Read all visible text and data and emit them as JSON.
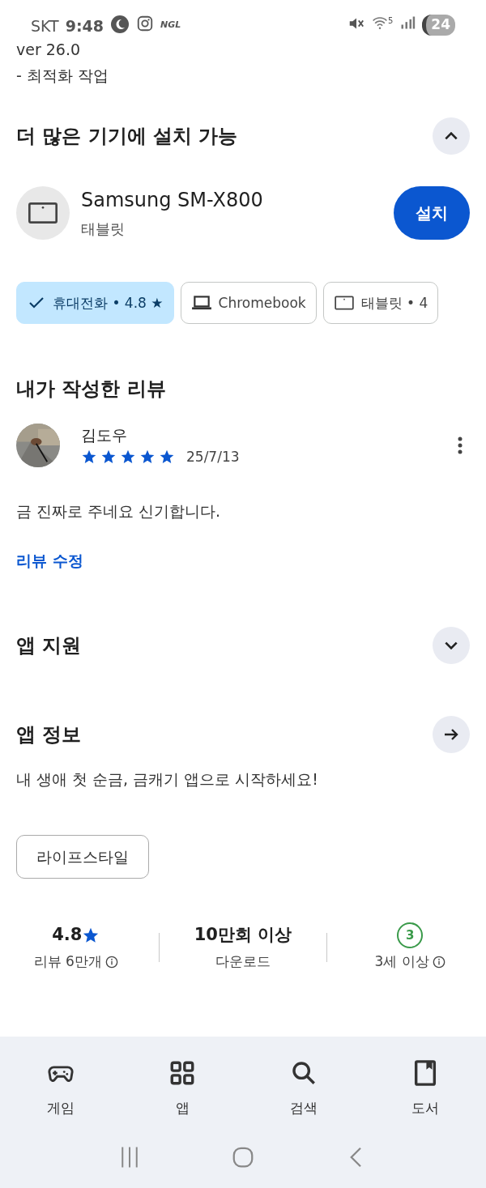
{
  "status_bar": {
    "carrier": "SKT",
    "time": "9:48",
    "notification_label": "NGL",
    "wifi_band": "5",
    "battery": "24"
  },
  "changelog": {
    "version": "ver 26.0",
    "lines": [
      "- 최적화 작업"
    ]
  },
  "more_devices": {
    "title": "더 많은 기기에 설치 가능",
    "expanded": true,
    "device": {
      "name": "Samsung SM-X800",
      "type": "태블릿",
      "button": "설치"
    },
    "chips": [
      {
        "label": "휴대전화 • 4.8 ★",
        "selected": true
      },
      {
        "kind": "laptop",
        "label": "Chromebook",
        "selected": false
      },
      {
        "kind": "tablet",
        "label": "태블릿 • 4",
        "selected": false
      }
    ]
  },
  "my_review": {
    "title": "내가 작성한 리뷰",
    "author": "김도우",
    "stars": 5,
    "date": "25/7/13",
    "text": "금 진짜로 주네요 신기합니다.",
    "edit_link": "리뷰 수정"
  },
  "sections": [
    {
      "kind": "expand",
      "title": "앱 지원",
      "expanded": false
    },
    {
      "kind": "arrow",
      "title": "앱 정보"
    }
  ],
  "description": "내 생애 첫 순금, 금캐기 앱으로 시작하세요!",
  "tag": "라이프스타일",
  "stats": [
    {
      "kind": "rating",
      "value": "4.8",
      "label": "리뷰 6만개",
      "info": true
    },
    {
      "kind": "text",
      "value": "10만회 이상",
      "label": "다운로드",
      "info": false
    },
    {
      "kind": "age",
      "value": "3",
      "label": "3세 이상",
      "info": true
    }
  ],
  "bottom_nav": [
    {
      "kind": "games",
      "label": "게임",
      "selected": false
    },
    {
      "kind": "apps",
      "label": "앱",
      "selected": false
    },
    {
      "kind": "search",
      "label": "검색",
      "selected": false
    },
    {
      "kind": "books",
      "label": "도서",
      "selected": false
    }
  ]
}
